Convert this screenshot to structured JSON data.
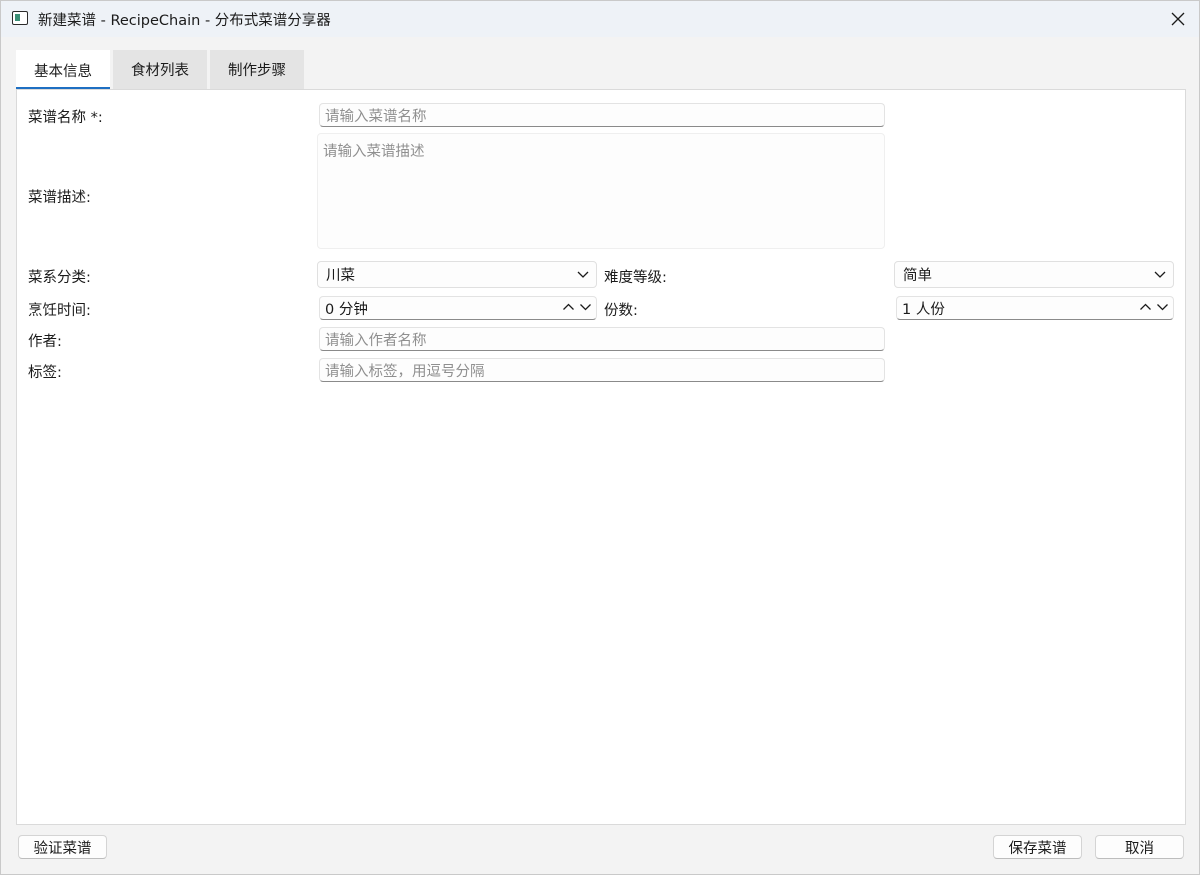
{
  "window": {
    "title": "新建菜谱 - RecipeChain - 分布式菜谱分享器",
    "icon": "app-window-icon",
    "close_icon": "close-icon"
  },
  "tabs": [
    {
      "label": "基本信息",
      "active": true
    },
    {
      "label": "食材列表",
      "active": false
    },
    {
      "label": "制作步骤",
      "active": false
    }
  ],
  "form": {
    "name": {
      "label": "菜谱名称 *:",
      "value": "",
      "placeholder": "请输入菜谱名称"
    },
    "description": {
      "label": "菜谱描述:",
      "value": "",
      "placeholder": "请输入菜谱描述"
    },
    "cuisine": {
      "label": "菜系分类:",
      "value": "川菜"
    },
    "difficulty": {
      "label": "难度等级:",
      "value": "简单"
    },
    "cook_time": {
      "label": "烹饪时间:",
      "value": "0 分钟"
    },
    "servings": {
      "label": "份数:",
      "value": "1 人份"
    },
    "author": {
      "label": "作者:",
      "value": "",
      "placeholder": "请输入作者名称"
    },
    "tags": {
      "label": "标签:",
      "value": "",
      "placeholder": "请输入标签，用逗号分隔"
    }
  },
  "buttons": {
    "validate": "验证菜谱",
    "save": "保存菜谱",
    "cancel": "取消"
  }
}
